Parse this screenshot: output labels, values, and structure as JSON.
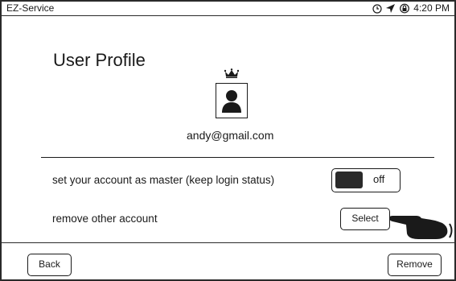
{
  "status_bar": {
    "app_title": "EZ-Service",
    "time": "4:20 PM",
    "icons": [
      "clock-icon",
      "location-arrow-icon",
      "lock-rotate-icon"
    ]
  },
  "profile": {
    "title": "User Profile",
    "email": "andy@gmail.com",
    "badge_icon": "crown-icon",
    "avatar_icon": "user-avatar-icon"
  },
  "settings": {
    "master_label": "set your account as master (keep login status)",
    "master_toggle_state": "off",
    "remove_label": "remove other account",
    "select_label": "Select"
  },
  "footer": {
    "back_label": "Back",
    "remove_label": "Remove"
  },
  "colors": {
    "ink": "#1a1a1a",
    "background": "#ffffff",
    "toggle_knob": "#2a2a2a"
  }
}
